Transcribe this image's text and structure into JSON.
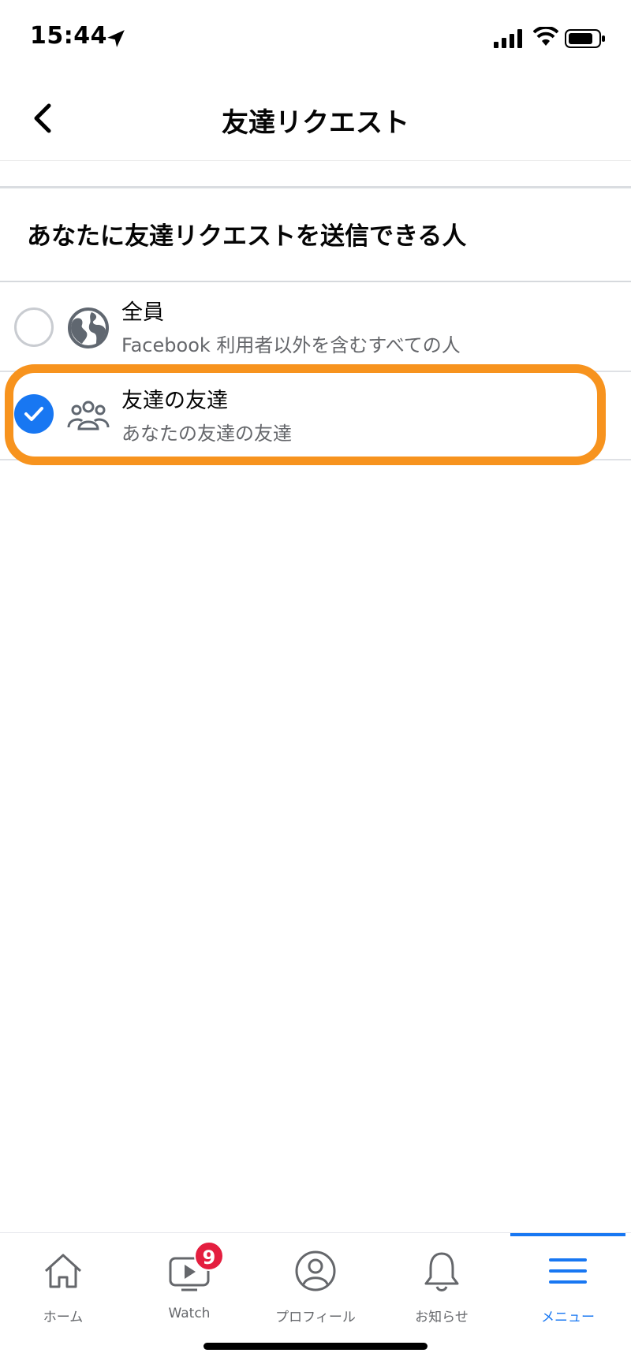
{
  "status_bar": {
    "time": "15:44"
  },
  "header": {
    "title": "友達リクエスト"
  },
  "section": {
    "heading": "あなたに友達リクエストを送信できる人"
  },
  "options": [
    {
      "title": "全員",
      "subtitle": "Facebook 利用者以外を含むすべての人",
      "selected": false,
      "icon": "globe-icon"
    },
    {
      "title": "友達の友達",
      "subtitle": "あなたの友達の友達",
      "selected": true,
      "icon": "friends-group-icon"
    }
  ],
  "tab_bar": {
    "tabs": [
      {
        "label": "ホーム",
        "icon": "home-icon"
      },
      {
        "label": "Watch",
        "icon": "watch-icon",
        "badge": "9"
      },
      {
        "label": "プロフィール",
        "icon": "profile-icon"
      },
      {
        "label": "お知らせ",
        "icon": "bell-icon"
      },
      {
        "label": "メニュー",
        "icon": "menu-icon",
        "active": true
      }
    ]
  },
  "colors": {
    "accent": "#1877f2",
    "highlight": "#f7931e",
    "badge": "#e41e3f"
  }
}
